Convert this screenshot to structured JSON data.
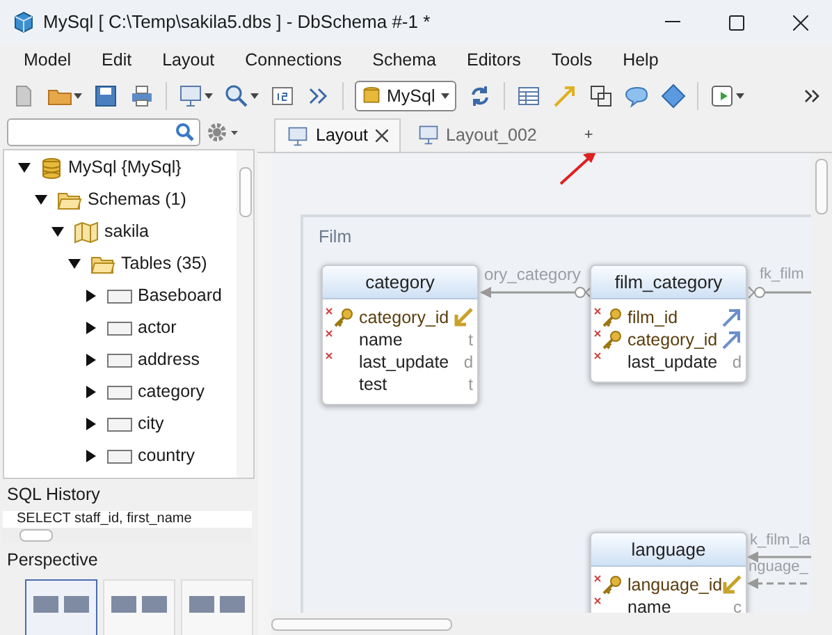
{
  "window": {
    "title": "MySql [ C:\\Temp\\sakila5.dbs ] - DbSchema #-1 *"
  },
  "menu": [
    "Model",
    "Edit",
    "Layout",
    "Connections",
    "Schema",
    "Editors",
    "Tools",
    "Help"
  ],
  "toolbar": {
    "database_dropdown": "MySql"
  },
  "tree": [
    {
      "label": "MySql {MySql}",
      "kind": "database",
      "expanded": true,
      "children": [
        {
          "label": "Schemas (1)",
          "kind": "folder",
          "expanded": true,
          "children": [
            {
              "label": "sakila",
              "kind": "schema",
              "expanded": true,
              "children": [
                {
                  "label": "Tables (35)",
                  "kind": "folder",
                  "expanded": true,
                  "children": [
                    {
                      "label": "Baseboard",
                      "kind": "table",
                      "expanded": false
                    },
                    {
                      "label": "actor",
                      "kind": "table",
                      "expanded": false
                    },
                    {
                      "label": "address",
                      "kind": "table",
                      "expanded": false
                    },
                    {
                      "label": "category",
                      "kind": "table",
                      "expanded": false
                    },
                    {
                      "label": "city",
                      "kind": "table",
                      "expanded": false
                    },
                    {
                      "label": "country",
                      "kind": "table",
                      "expanded": false
                    }
                  ]
                }
              ]
            }
          ]
        }
      ]
    }
  ],
  "sql_history": {
    "title": "SQL History",
    "entries": [
      "SELECT staff_id, first_name"
    ]
  },
  "perspective": {
    "title": "Perspective",
    "layouts": [
      {
        "selected": true
      },
      {
        "selected": false
      },
      {
        "selected": false
      }
    ]
  },
  "tabs": [
    {
      "label": "Layout",
      "selected": true,
      "closable": true
    },
    {
      "label": "Layout_002",
      "selected": false,
      "closable": false
    }
  ],
  "new_tab": "+",
  "diagram": {
    "group": "Film",
    "tables": [
      {
        "name": "category",
        "columns": [
          {
            "name": "category_id",
            "primary_key": true,
            "required": true,
            "kind": "referenced"
          },
          {
            "name": "name",
            "primary_key": false,
            "required": true,
            "kind": "plain",
            "type": "t"
          },
          {
            "name": "last_update",
            "primary_key": false,
            "required": true,
            "kind": "plain",
            "type": "d"
          },
          {
            "name": "test",
            "primary_key": false,
            "required": false,
            "kind": "plain",
            "type": "t"
          }
        ]
      },
      {
        "name": "film_category",
        "columns": [
          {
            "name": "film_id",
            "primary_key": true,
            "required": true,
            "kind": "foreign"
          },
          {
            "name": "category_id",
            "primary_key": true,
            "required": true,
            "kind": "foreign"
          },
          {
            "name": "last_update",
            "primary_key": false,
            "required": true,
            "kind": "plain",
            "type": "d"
          }
        ]
      },
      {
        "name": "language",
        "columns": [
          {
            "name": "language_id",
            "primary_key": true,
            "required": true,
            "kind": "referenced"
          },
          {
            "name": "name",
            "primary_key": false,
            "required": true,
            "kind": "plain",
            "type": "c"
          }
        ]
      }
    ],
    "relations": [
      "ory_category",
      "fk_film",
      "k_film_la",
      "nguage_"
    ]
  }
}
